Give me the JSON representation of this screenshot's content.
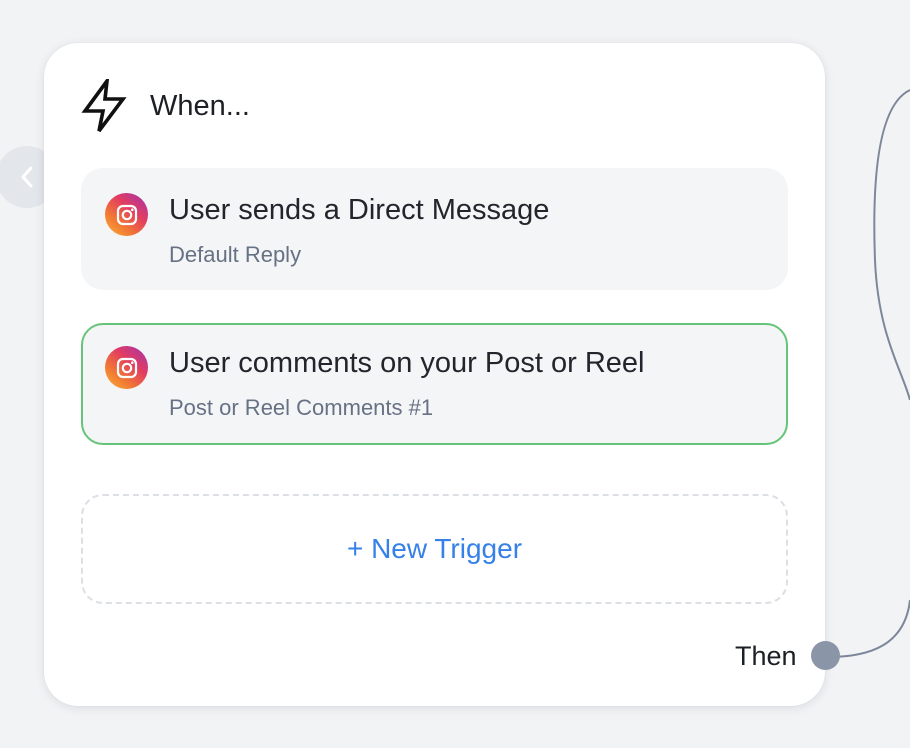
{
  "trigger_card": {
    "header_title": "When...",
    "triggers": [
      {
        "title": "User sends a Direct Message",
        "subtitle": "Default Reply",
        "icon": "instagram-icon",
        "selected": false
      },
      {
        "title": "User comments on your Post or Reel",
        "subtitle": "Post or Reel Comments #1",
        "icon": "instagram-icon",
        "selected": true
      }
    ],
    "new_trigger_label": "+ New Trigger",
    "then_label": "Then"
  },
  "colors": {
    "canvas_background": "#f2f3f5",
    "selected_border": "#66c47a",
    "link_blue": "#3581e8",
    "connector": "#7d879a"
  }
}
